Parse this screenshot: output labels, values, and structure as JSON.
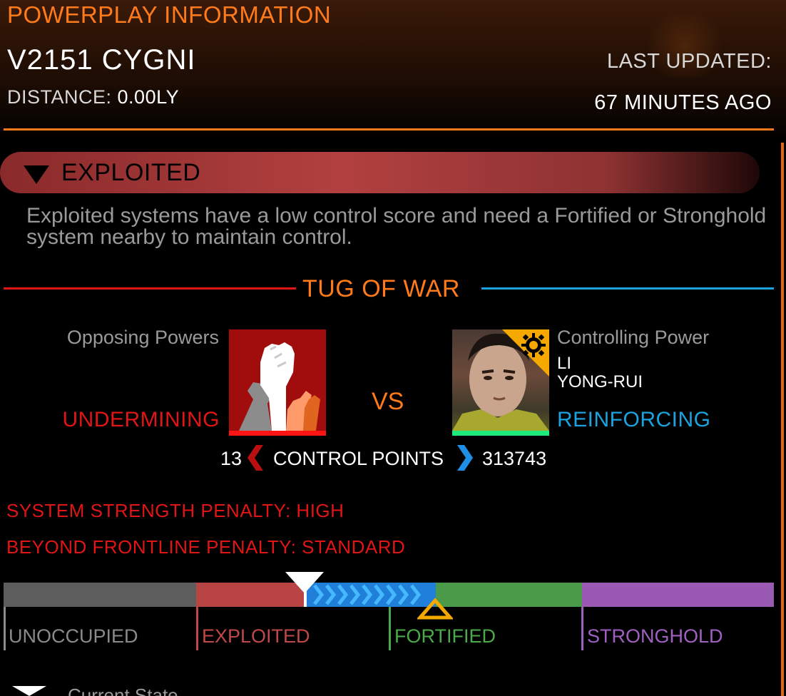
{
  "header": {
    "title": "POWERPLAY INFORMATION",
    "system_name": "V2151 CYGNI",
    "distance_label": "DISTANCE:",
    "distance_value": "0.00LY",
    "last_updated_label": "LAST UPDATED:",
    "last_updated_value": "67 MINUTES AGO"
  },
  "state": {
    "label": "EXPLOITED",
    "description": "Exploited systems have a low control score and need a Fortified or Stronghold system nearby to maintain control."
  },
  "tug_of_war": {
    "title": "TUG OF WAR",
    "opposing_label": "Opposing Powers",
    "controlling_label": "Controlling Power",
    "leader_line1": "LI",
    "leader_line2": "YONG-RUI",
    "opposing_action": "UNDERMINING",
    "controlling_action": "REINFORCING",
    "vs": "VS",
    "control_points_label": "CONTROL POINTS",
    "opposing_points": "13",
    "controlling_points": "313743"
  },
  "penalties": {
    "system_strength": "SYSTEM STRENGTH PENALTY: HIGH",
    "beyond_frontline": "BEYOND FRONTLINE PENALTY: STANDARD"
  },
  "progress": {
    "tiers": [
      "UNOCCUPIED",
      "EXPLOITED",
      "FORTIFIED",
      "STRONGHOLD"
    ],
    "current_marker_label": "Current State"
  },
  "colors": {
    "accent": "#ff7a1a",
    "undermining": "#e01515",
    "reinforcing": "#1ba3e0",
    "unoccupied": "#5d5d5d",
    "exploited": "#b84444",
    "fortified": "#4a9a4a",
    "stronghold": "#9a5ab4"
  },
  "icons": {
    "opposing": "raised-fists-icon",
    "controlling": "li-yong-rui-portrait",
    "power_badge": "sun-gear-icon"
  }
}
